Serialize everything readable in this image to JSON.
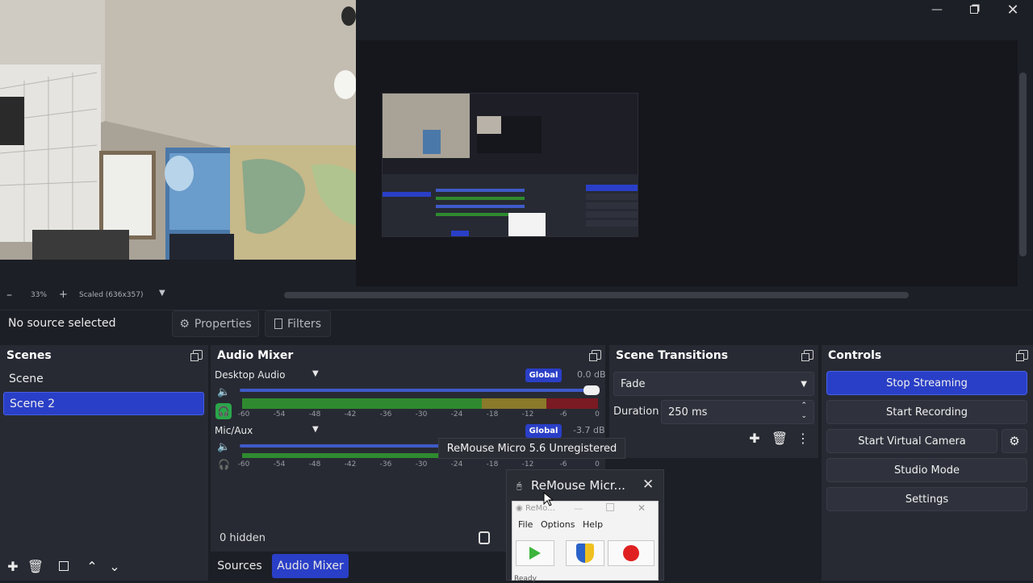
{
  "window": {
    "minimize_icon": "minimize-icon",
    "maximize_icon": "restore-icon",
    "close_icon": "close-icon"
  },
  "preview": {
    "zoom": "33%",
    "scale_mode": "Scaled (636x357)"
  },
  "source_toolbar": {
    "status": "No source selected",
    "properties_label": "Properties",
    "filters_label": "Filters"
  },
  "scenes": {
    "title": "Scenes",
    "items": [
      {
        "label": "Scene",
        "active": false
      },
      {
        "label": "Scene 2",
        "active": true
      }
    ]
  },
  "audio_mixer": {
    "title": "Audio Mixer",
    "channels": [
      {
        "name": "Desktop Audio",
        "scope": "Global",
        "db": "0.0 dB",
        "level": 1.0
      },
      {
        "name": "Mic/Aux",
        "scope": "Global",
        "db": "-3.7 dB",
        "level": 0.82
      }
    ],
    "ticks": [
      "-60",
      "-54",
      "-48",
      "-42",
      "-36",
      "-30",
      "-24",
      "-18",
      "-12",
      "-6",
      "0"
    ],
    "hidden": "0 hidden"
  },
  "scene_transitions": {
    "title": "Scene Transitions",
    "transition": "Fade",
    "duration_label": "Duration",
    "duration_value": "250 ms"
  },
  "controls": {
    "title": "Controls",
    "stop_streaming": "Stop Streaming",
    "start_recording": "Start Recording",
    "start_virtual_camera": "Start Virtual Camera",
    "studio_mode": "Studio Mode",
    "settings": "Settings"
  },
  "tabs": {
    "sources": "Sources",
    "audio_mixer": "Audio Mixer"
  },
  "remouse": {
    "tooltip": "ReMouse Micro 5.6 Unregistered",
    "frame_title": "ReMouse Micr...",
    "inner_title": "ReMo...",
    "menu": [
      "File",
      "Options",
      "Help"
    ],
    "status": "Ready"
  },
  "colors": {
    "accent": "#2a3fc7",
    "meter_green": "#2f8a2f",
    "meter_yellow": "#8a7a2a",
    "meter_red": "#7a1a22",
    "monitor_green": "#2aa64a"
  }
}
